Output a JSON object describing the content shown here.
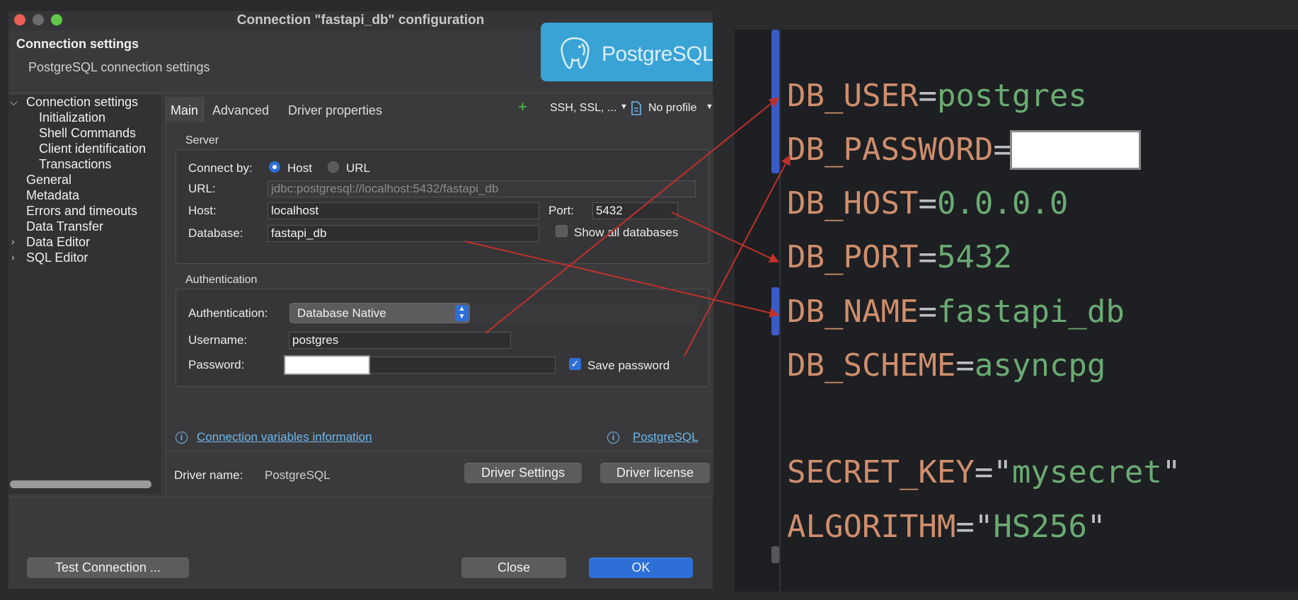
{
  "dialog": {
    "title": "Connection \"fastapi_db\" configuration",
    "header_title": "Connection settings",
    "header_subtitle": "PostgreSQL connection settings",
    "logo_text": "PostgreSQL"
  },
  "tree": {
    "items": [
      {
        "label": "Connection settings",
        "expanded": true
      },
      {
        "label": "Initialization"
      },
      {
        "label": "Shell Commands"
      },
      {
        "label": "Client identification"
      },
      {
        "label": "Transactions"
      },
      {
        "label": "General"
      },
      {
        "label": "Metadata"
      },
      {
        "label": "Errors and timeouts"
      },
      {
        "label": "Data Transfer"
      },
      {
        "label": "Data Editor",
        "expandable": true
      },
      {
        "label": "SQL Editor",
        "expandable": true
      }
    ]
  },
  "tabs": [
    "Main",
    "Advanced",
    "Driver properties"
  ],
  "toolbar": {
    "ssh": "SSH, SSL, ...",
    "profile": "No profile"
  },
  "server": {
    "group_label": "Server",
    "connect_by_label": "Connect by:",
    "option_host": "Host",
    "option_url": "URL",
    "selected": "Host",
    "url_label": "URL:",
    "url_value": "jdbc:postgresql://localhost:5432/fastapi_db",
    "host_label": "Host:",
    "host_value": "localhost",
    "port_label": "Port:",
    "port_value": "5432",
    "database_label": "Database:",
    "database_value": "fastapi_db",
    "show_all_label": "Show all databases"
  },
  "auth": {
    "group_label": "Authentication",
    "auth_label": "Authentication:",
    "auth_value": "Database Native",
    "username_label": "Username:",
    "username_value": "postgres",
    "password_label": "Password:",
    "save_password_label": "Save password"
  },
  "links": {
    "conn_vars": "Connection variables information",
    "postgres": "PostgreSQL"
  },
  "driver": {
    "label": "Driver name:",
    "value": "PostgreSQL",
    "settings_button": "Driver Settings",
    "license_button": "Driver license"
  },
  "footer": {
    "test_button": "Test Connection ...",
    "close_button": "Close",
    "ok_button": "OK"
  },
  "editor": {
    "lines": [
      {
        "key": "DB_USER",
        "value": "postgres"
      },
      {
        "key": "DB_PASSWORD",
        "value": ""
      },
      {
        "key": "DB_HOST",
        "value": "0.0.0.0"
      },
      {
        "key": "DB_PORT",
        "value": "5432"
      },
      {
        "key": "DB_NAME",
        "value": "fastapi_db"
      },
      {
        "key": "DB_SCHEME",
        "value": "asyncpg"
      },
      {
        "key": "SECRET_KEY",
        "value": "mysecret",
        "quoted": true
      },
      {
        "key": "ALGORITHM",
        "value": "HS256",
        "quoted": true
      }
    ]
  },
  "colors": {
    "accent": "#2d6fd6",
    "link": "#6fb7ea",
    "annotation_arrow": "#c0302b",
    "env_key": "#cf8e6d",
    "env_value": "#6aab73"
  }
}
